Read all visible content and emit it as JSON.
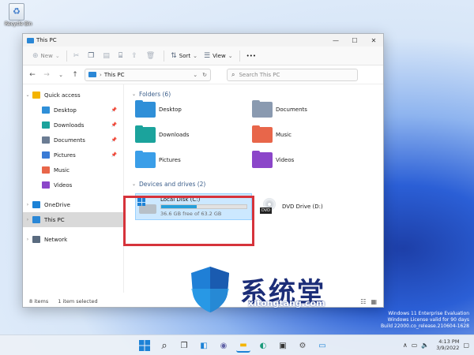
{
  "desktop": {
    "recycle_bin_label": "Recycle Bin"
  },
  "window": {
    "title": "This PC",
    "controls": {
      "minimize": "—",
      "maximize": "☐",
      "close": "✕"
    }
  },
  "command_bar": {
    "new_label": "New",
    "sort_label": "Sort",
    "view_label": "View",
    "more_label": "•••"
  },
  "nav": {
    "back": "←",
    "forward": "→",
    "up": "↑",
    "recent": "⌄",
    "address": "This PC",
    "address_chevron": "⌄",
    "refresh": "↻",
    "search_placeholder": "Search This PC"
  },
  "sidebar": {
    "items": [
      {
        "label": "Quick access",
        "arrow": "⌄",
        "color": "#f4b400",
        "pinned": false
      },
      {
        "label": "Desktop",
        "arrow": "",
        "color": "#2f8fd8",
        "pinned": true
      },
      {
        "label": "Downloads",
        "arrow": "",
        "color": "#1ba39c",
        "pinned": true
      },
      {
        "label": "Documents",
        "arrow": "",
        "color": "#6b7c93",
        "pinned": true
      },
      {
        "label": "Pictures",
        "arrow": "",
        "color": "#3a7bd5",
        "pinned": true
      },
      {
        "label": "Music",
        "arrow": "",
        "color": "#e8664a",
        "pinned": false
      },
      {
        "label": "Videos",
        "arrow": "",
        "color": "#8b46c9",
        "pinned": false
      },
      {
        "label": "OneDrive",
        "arrow": "›",
        "color": "#1c82d6",
        "pinned": false
      },
      {
        "label": "This PC",
        "arrow": "›",
        "color": "#2a87d6",
        "pinned": false
      },
      {
        "label": "Network",
        "arrow": "›",
        "color": "#5a6b7f",
        "pinned": false
      }
    ],
    "pin_glyph": "📌"
  },
  "main": {
    "folders_header": "Folders (6)",
    "folders": [
      {
        "label": "Desktop",
        "color": "#2f8fd8"
      },
      {
        "label": "Documents",
        "color": "#8a9ab0"
      },
      {
        "label": "Downloads",
        "color": "#1ba39c"
      },
      {
        "label": "Music",
        "color": "#e8664a"
      },
      {
        "label": "Pictures",
        "color": "#3a9ee8"
      },
      {
        "label": "Videos",
        "color": "#8b46c9"
      }
    ],
    "devices_header": "Devices and drives (2)",
    "drives": [
      {
        "label": "Local Disk (C:)",
        "free": "36.6 GB free of 63.2 GB",
        "used_percent": 42
      },
      {
        "label": "DVD Drive (D:)",
        "tag": "DVD"
      }
    ]
  },
  "status": {
    "items": "8 items",
    "selected": "1 item selected"
  },
  "watermark": {
    "line1": "Windows 11 Enterprise Evaluation",
    "line2": "Windows License valid for 90 days",
    "line3": "Build 22000.co_release.210604-1628",
    "brand": "系统堂",
    "url": "xitongtang.com"
  },
  "taskbar": {
    "time": "4:13 PM",
    "date": "3/9/2022",
    "tray_expand": "∧"
  },
  "colors": {
    "accent": "#26a0da",
    "highlight": "#cce8ff",
    "red_frame": "#d6333b"
  }
}
